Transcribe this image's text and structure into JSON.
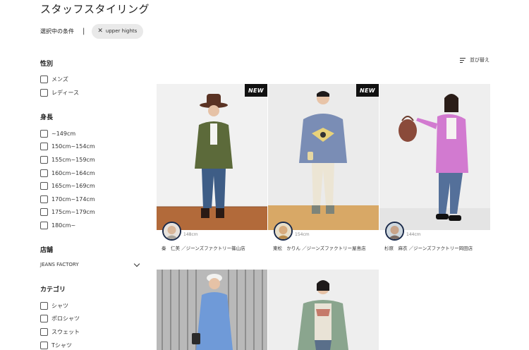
{
  "page": {
    "title": "スタッフスタイリング",
    "condition_label": "選択中の条件",
    "condition_sep": "|",
    "chip": {
      "label": "upper hights",
      "close_glyph": "✕"
    },
    "sort_label": "並び替え"
  },
  "filters": {
    "gender": {
      "title": "性別",
      "options": [
        "メンズ",
        "レディース"
      ]
    },
    "height": {
      "title": "身長",
      "options": [
        "~149cm",
        "150cm~154cm",
        "155cm~159cm",
        "160cm~164cm",
        "165cm~169cm",
        "170cm~174cm",
        "175cm~179cm",
        "180cm~"
      ]
    },
    "store": {
      "title": "店舗",
      "selected": "JEANS FACTORY"
    },
    "category": {
      "title": "カテゴリ",
      "options": [
        "シャツ",
        "ポロシャツ",
        "スウェット",
        "Tシャツ"
      ]
    }
  },
  "cards": [
    {
      "badge": "NEW",
      "height": "148cm",
      "name": "秦　仁美 ／ジーンズファクトリー篠山店"
    },
    {
      "badge": "NEW",
      "height": "154cm",
      "name": "東松　かりん ／ジーンズファクトリー屋島店"
    },
    {
      "badge": "",
      "height": "144cm",
      "name": "杉原　麻衣 ／ジーンズファクトリー岡田店"
    },
    {
      "badge": "",
      "height": "",
      "name": ""
    },
    {
      "badge": "",
      "height": "",
      "name": ""
    }
  ],
  "colors": {
    "badge_bg": "#111111",
    "avatar_ring": "#1a2a4a",
    "chip_bg": "#e9e9e9"
  }
}
